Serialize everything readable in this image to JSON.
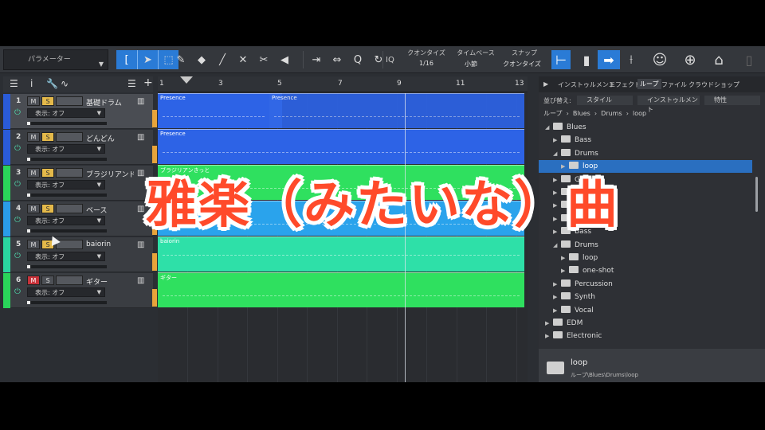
{
  "toolbar": {
    "param_label": "パラメーター",
    "quantize_label": "クオンタイズ",
    "quantize_value": "1/16",
    "timebase_label": "タイムベース",
    "timebase_value": "小節",
    "snap_label": "スナップ",
    "snap_value": "クオンタイズ",
    "iq_label": "IQ",
    "q_label": "Q"
  },
  "ruler": {
    "ticks": [
      "1",
      "3",
      "5",
      "7",
      "9",
      "11",
      "13"
    ]
  },
  "tracks": [
    {
      "num": "1",
      "name": "基礎ドラム",
      "mute": "M",
      "solo": "S",
      "display": "表示: オフ",
      "color": "#2a5bd8"
    },
    {
      "num": "2",
      "name": "どんどん",
      "mute": "M",
      "solo": "S",
      "display": "表示: オフ",
      "color": "#2a5bd8"
    },
    {
      "num": "3",
      "name": "ブラジリアンドラム",
      "mute": "M",
      "solo": "S",
      "display": "表示: オフ",
      "color": "#2ad45a"
    },
    {
      "num": "4",
      "name": "ベース",
      "mute": "M",
      "solo": "S",
      "display": "表示: オフ",
      "color": "#2a9ce8"
    },
    {
      "num": "5",
      "name": "baiorin",
      "mute": "M",
      "solo": "S",
      "display": "表示: オフ",
      "color": "#2ad4a0"
    },
    {
      "num": "6",
      "name": "ギター",
      "mute": "M",
      "solo": "S",
      "display": "表示: オフ",
      "color": "#2ad45a"
    }
  ],
  "clips": {
    "c1": "Presence",
    "c2": "Presence",
    "c3": "Presence",
    "c4": "ブラジリアンきっと",
    "c5": "baiorin",
    "c6": "ギター"
  },
  "browser": {
    "tabs": [
      "インストゥルメント",
      "エフェクト",
      "ループ",
      "ファイル",
      "クラウド",
      "ショップ"
    ],
    "sort_label": "並び替え:",
    "sort_style": "スタイル",
    "sort_instrument": "インストゥルメント",
    "sort_feature": "特性",
    "breadcrumb": [
      "ループ",
      "Blues",
      "Drums",
      "loop"
    ],
    "tree": [
      {
        "label": "Blues",
        "level": 0,
        "open": true
      },
      {
        "label": "Bass",
        "level": 1,
        "open": false
      },
      {
        "label": "Drums",
        "level": 1,
        "open": true
      },
      {
        "label": "loop",
        "level": 2,
        "open": false,
        "selected": true
      },
      {
        "label": "Guitar",
        "level": 1,
        "open": false
      },
      {
        "label": "Organ",
        "level": 1,
        "open": false
      },
      {
        "label": "Vocal",
        "level": 1,
        "open": false
      },
      {
        "label": "Sweep",
        "level": 1,
        "open": false
      },
      {
        "label": "Bass",
        "level": 1,
        "open": false
      },
      {
        "label": "Drums",
        "level": 1,
        "open": true
      },
      {
        "label": "loop",
        "level": 2,
        "open": false
      },
      {
        "label": "one-shot",
        "level": 2,
        "open": false
      },
      {
        "label": "Percussion",
        "level": 1,
        "open": false
      },
      {
        "label": "Synth",
        "level": 1,
        "open": false
      },
      {
        "label": "Vocal",
        "level": 1,
        "open": false
      },
      {
        "label": "EDM",
        "level": 0,
        "open": false
      },
      {
        "label": "Electronic",
        "level": 0,
        "open": false
      }
    ],
    "footer_name": "loop",
    "footer_path": "ループ\\Blues\\Drums\\loop"
  },
  "caption": "雅楽（みたいな）曲"
}
